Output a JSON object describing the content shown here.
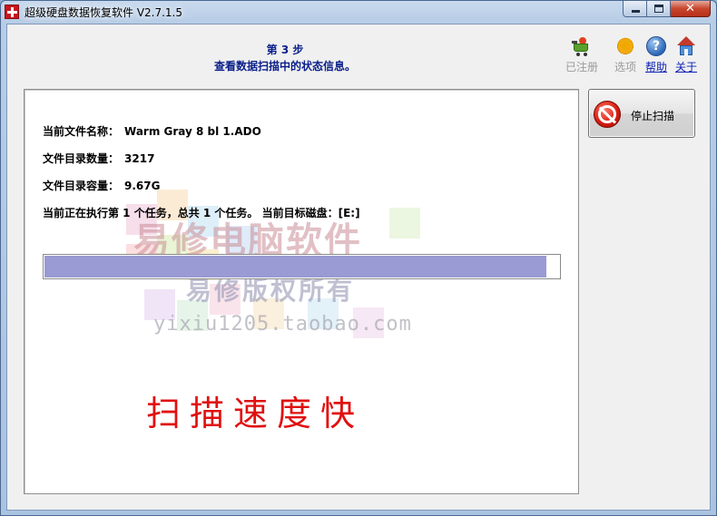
{
  "window": {
    "title": "超级硬盘数据恢复软件 V2.7.1.5",
    "controls": {
      "minimize": "",
      "maximize": "",
      "close": "✕"
    }
  },
  "header": {
    "step": "第 3 步",
    "subtitle": "查看数据扫描中的状态信息。"
  },
  "toolbar": {
    "register": "已注册",
    "options": "选项",
    "help": "帮助",
    "about": "关于",
    "icons": [
      "cart-icon",
      "gear-icon",
      "help-icon",
      "home-icon"
    ]
  },
  "status": {
    "current_file_label": "当前文件名称：",
    "current_file_value": "Warm Gray 8 bl 1.ADO",
    "dir_count_label": "文件目录数量：",
    "dir_count_value": "3217",
    "dir_size_label": "文件目录容量：",
    "dir_size_value": "9.67G",
    "task_text": "当前正在执行第 1 个任务，总共 1 个任务。 当前目标磁盘：[E:]"
  },
  "progress": {
    "percent": 97.5,
    "color": "#9a9ad4"
  },
  "watermark": {
    "line1": "易修电脑软件",
    "line2": "易修版权所有",
    "line3": "yixiu1205.taobao.com"
  },
  "caption": "扫描速度快",
  "actions": {
    "stop_scan": "停止扫描"
  }
}
